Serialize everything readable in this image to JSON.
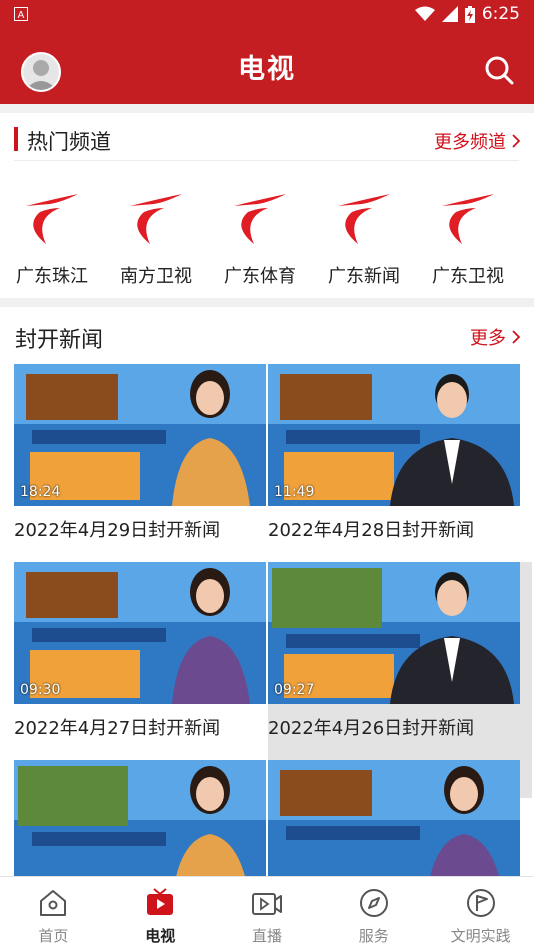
{
  "status_bar": {
    "time": "6:25",
    "icons": [
      "app-a-icon",
      "wifi-icon",
      "signal-icon",
      "battery-charging-icon"
    ]
  },
  "header": {
    "title": "电视",
    "accent": "#c41d22"
  },
  "hot_channels": {
    "title": "热门频道",
    "more": "更多频道",
    "items": [
      {
        "name": "广东珠江"
      },
      {
        "name": "南方卫视"
      },
      {
        "name": "广东体育"
      },
      {
        "name": "广东新闻"
      },
      {
        "name": "广东卫视"
      }
    ]
  },
  "news": {
    "title": "封开新闻",
    "more": "更多",
    "videos": [
      {
        "title": "2022年4月29日封开新闻",
        "duration": "18:24"
      },
      {
        "title": "2022年4月28日封开新闻",
        "duration": "11:49"
      },
      {
        "title": "2022年4月27日封开新闻",
        "duration": "09:30"
      },
      {
        "title": "2022年4月26日封开新闻",
        "duration": "09:27"
      },
      {
        "title": "",
        "duration": ""
      },
      {
        "title": "",
        "duration": ""
      }
    ]
  },
  "tabs": [
    {
      "label": "首页",
      "icon": "home-icon"
    },
    {
      "label": "电视",
      "icon": "tv-icon",
      "active": true
    },
    {
      "label": "直播",
      "icon": "live-video-icon"
    },
    {
      "label": "服务",
      "icon": "compass-icon"
    },
    {
      "label": "文明实践",
      "icon": "flag-circle-icon"
    }
  ]
}
